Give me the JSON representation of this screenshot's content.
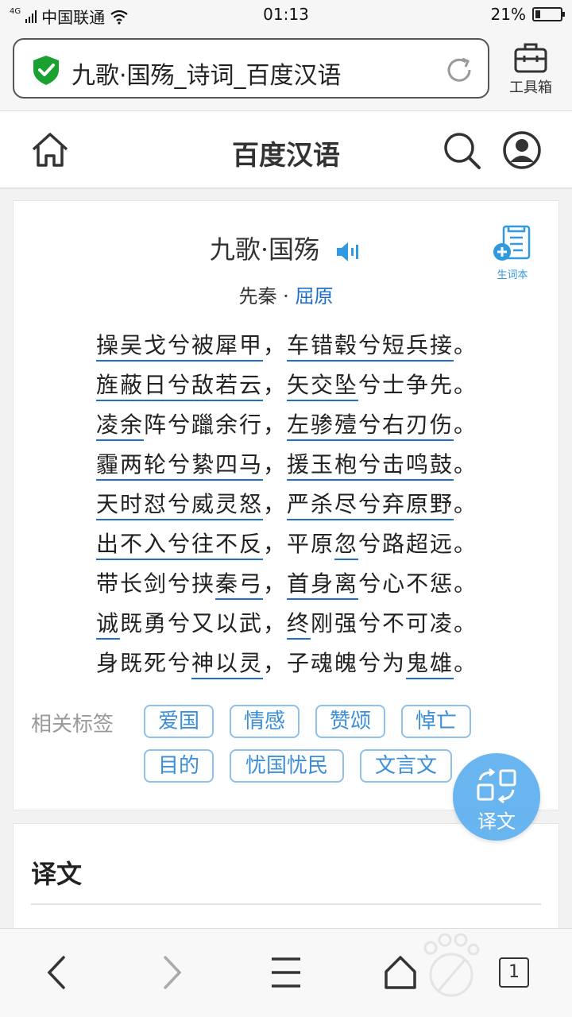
{
  "status_bar": {
    "network": "4G",
    "carrier": "中国联通",
    "time": "01:13",
    "battery_percent": "21%",
    "battery_level": 0.21
  },
  "browser": {
    "url_title": "九歌·国殇_诗词_百度汉语",
    "toolbox_label": "工具箱",
    "icons": [
      "shield-check-icon",
      "reload-icon",
      "toolbox-icon"
    ]
  },
  "header": {
    "title": "百度汉语",
    "icons": [
      "home-icon",
      "search-icon",
      "user-icon"
    ]
  },
  "poem": {
    "title": "九歌·国殇",
    "dynasty": "先秦",
    "separator": "·",
    "author": "屈原",
    "vocab_label": "生词本",
    "lines": [
      [
        [
          "操吴戈兮被犀甲",
          true
        ],
        [
          "，",
          false
        ],
        [
          "车错毂兮短兵接",
          true
        ],
        [
          "。",
          false
        ]
      ],
      [
        [
          "旌蔽日兮敌若云",
          true
        ],
        [
          "，",
          false
        ],
        [
          "矢交坠",
          true
        ],
        [
          "兮士争先。",
          false
        ]
      ],
      [
        [
          "凌余",
          true
        ],
        [
          "阵兮躐余行，",
          false
        ],
        [
          "左骖殪兮右刃伤",
          true
        ],
        [
          "。",
          false
        ]
      ],
      [
        [
          "霾两轮兮絷四马",
          true
        ],
        [
          "，",
          false
        ],
        [
          "援玉枹兮击鸣鼓",
          true
        ],
        [
          "。",
          false
        ]
      ],
      [
        [
          "天时怼兮威灵怒",
          true
        ],
        [
          "，",
          false
        ],
        [
          "严杀尽兮弃原野",
          true
        ],
        [
          "。",
          false
        ]
      ],
      [
        [
          "出不入兮往不反",
          true
        ],
        [
          "，平原",
          false
        ],
        [
          "忽",
          true
        ],
        [
          "兮路超远。",
          false
        ]
      ],
      [
        [
          "带长剑兮挟",
          false
        ],
        [
          "秦弓",
          true
        ],
        [
          "，",
          false
        ],
        [
          "首身离",
          true
        ],
        [
          "兮心不惩。",
          false
        ]
      ],
      [
        [
          "诚",
          true
        ],
        [
          "既勇兮又以武，",
          false
        ],
        [
          "终",
          true
        ],
        [
          "刚强兮不可凌。",
          false
        ]
      ],
      [
        [
          "身既死兮",
          false
        ],
        [
          "神以灵",
          true
        ],
        [
          "，子魂魄兮为",
          false
        ],
        [
          "鬼雄",
          true
        ],
        [
          "。",
          false
        ]
      ]
    ]
  },
  "tags": {
    "label": "相关标签",
    "items": [
      "爱国",
      "情感",
      "赞颂",
      "悼亡",
      "目的",
      "忧国忧民",
      "文言文"
    ]
  },
  "fab": {
    "label": "译文"
  },
  "translation": {
    "heading": "译文"
  },
  "bottom_nav": {
    "tab_count": "1",
    "icons": [
      "back-icon",
      "forward-icon",
      "menu-icon",
      "home-icon",
      "tabs-icon"
    ]
  }
}
